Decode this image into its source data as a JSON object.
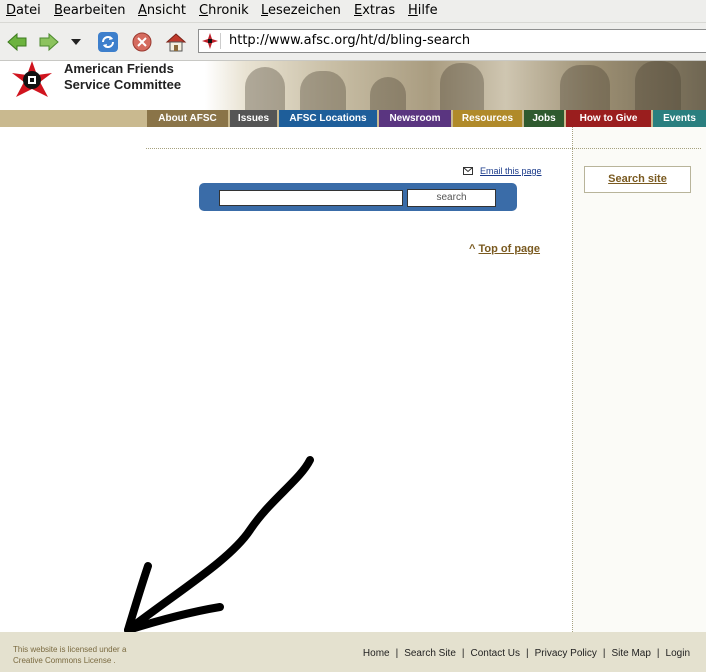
{
  "menubar": {
    "items": [
      "Datei",
      "Bearbeiten",
      "Ansicht",
      "Chronik",
      "Lesezeichen",
      "Extras",
      "Hilfe"
    ]
  },
  "navbar": {
    "url": "http://www.afsc.org/ht/d/bling-search"
  },
  "header": {
    "org_name_line1": "American Friends",
    "org_name_line2": "Service Committee"
  },
  "tabs": [
    {
      "label": "About AFSC",
      "color": "#8a7448"
    },
    {
      "label": "Issues",
      "color": "#555555"
    },
    {
      "label": "AFSC Locations",
      "color": "#1e5e9a"
    },
    {
      "label": "Newsroom",
      "color": "#5a3580"
    },
    {
      "label": "Resources",
      "color": "#b08a2a"
    },
    {
      "label": "Jobs",
      "color": "#2f5a2f"
    },
    {
      "label": "How to Give",
      "color": "#9a1e1e"
    },
    {
      "label": "Events",
      "color": "#2a7f7f"
    }
  ],
  "content": {
    "email_link": "Email this page",
    "search_value": "",
    "search_button": "search",
    "top_link_caret": "^",
    "top_link": "Top of page"
  },
  "sidebar": {
    "search_site": "Search site"
  },
  "footer": {
    "license_line1": "This website is licensed under a",
    "license_line2": "Creative Commons License .",
    "links": [
      "Home",
      "Search Site",
      "Contact Us",
      "Privacy Policy",
      "Site Map",
      "Login"
    ]
  }
}
